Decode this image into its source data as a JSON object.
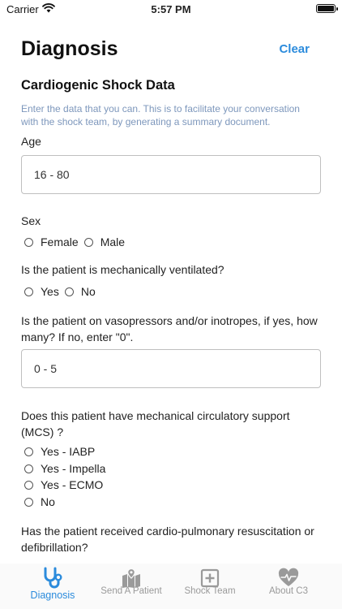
{
  "status": {
    "carrier": "Carrier",
    "time": "5:57 PM"
  },
  "header": {
    "title": "Diagnosis",
    "clear_label": "Clear"
  },
  "section": {
    "title": "Cardiogenic Shock Data",
    "intro": "Enter the data that you can. This is to facilitate your conversation with the shock team, by generating a summary document."
  },
  "form": {
    "age": {
      "label": "Age",
      "placeholder": "16 - 80"
    },
    "sex": {
      "label": "Sex",
      "options": [
        "Female",
        "Male"
      ]
    },
    "ventilated": {
      "label": "Is the patient is mechanically ventilated?",
      "options": [
        "Yes",
        "No"
      ]
    },
    "vasopressors": {
      "label": "Is the patient on vasopressors and/or inotropes, if yes, how many? If no, enter \"0\".",
      "placeholder": "0 - 5"
    },
    "mcs": {
      "label": "Does this patient have mechanical circulatory support (MCS) ?",
      "options": [
        "Yes - IABP",
        "Yes - Impella",
        "Yes - ECMO",
        "No"
      ]
    },
    "cpr": {
      "label": "Has the patient received cardio-pulmonary resuscitation or defibrillation?"
    }
  },
  "tabs": [
    {
      "label": "Diagnosis",
      "icon": "stethoscope-icon",
      "active": true
    },
    {
      "label": "Send A Patient",
      "icon": "map-pin-icon",
      "active": false
    },
    {
      "label": "Shock Team",
      "icon": "plus-square-icon",
      "active": false
    },
    {
      "label": "About C3",
      "icon": "heartbeat-icon",
      "active": false
    }
  ],
  "colors": {
    "accent": "#2b8bdc",
    "intro_text": "#7d97bc",
    "tab_inactive": "#9a9a9a"
  }
}
